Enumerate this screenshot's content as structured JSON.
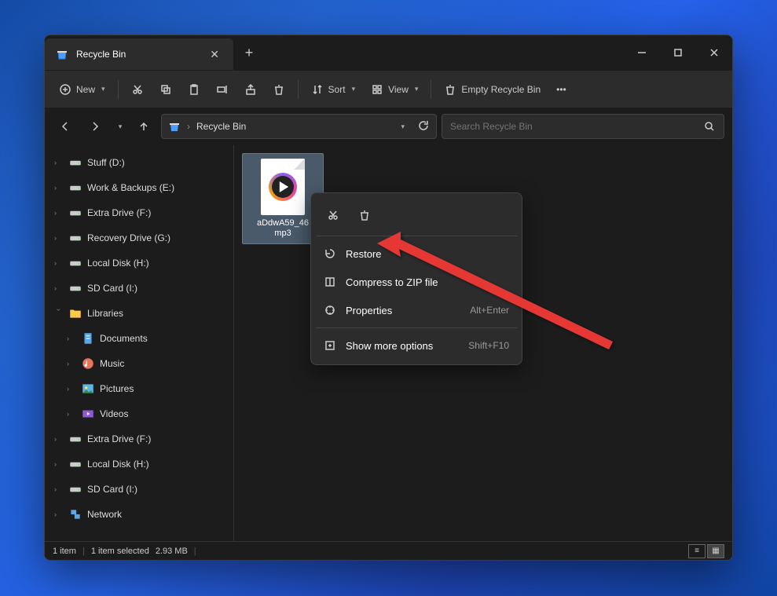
{
  "tab": {
    "title": "Recycle Bin"
  },
  "toolbar": {
    "new": "New",
    "sort": "Sort",
    "view": "View",
    "empty": "Empty Recycle Bin"
  },
  "address": {
    "location": "Recycle Bin"
  },
  "search": {
    "placeholder": "Search Recycle Bin"
  },
  "sidebar": [
    {
      "label": "Stuff (D:)",
      "icon": "drive"
    },
    {
      "label": "Work & Backups (E:)",
      "icon": "drive"
    },
    {
      "label": "Extra Drive (F:)",
      "icon": "drive"
    },
    {
      "label": "Recovery Drive (G:)",
      "icon": "drive"
    },
    {
      "label": "Local Disk (H:)",
      "icon": "drive"
    },
    {
      "label": "SD Card (I:)",
      "icon": "drive"
    },
    {
      "label": "Libraries",
      "icon": "folder",
      "expanded": true
    },
    {
      "label": "Documents",
      "icon": "doc",
      "indent": true
    },
    {
      "label": "Music",
      "icon": "music",
      "indent": true
    },
    {
      "label": "Pictures",
      "icon": "pic",
      "indent": true
    },
    {
      "label": "Videos",
      "icon": "vid",
      "indent": true
    },
    {
      "label": "Extra Drive (F:)",
      "icon": "drive"
    },
    {
      "label": "Local Disk (H:)",
      "icon": "drive"
    },
    {
      "label": "SD Card (I:)",
      "icon": "drive"
    },
    {
      "label": "Network",
      "icon": "net"
    }
  ],
  "file": {
    "name": "aDdwA59_46\nmp3"
  },
  "contextmenu": {
    "restore": "Restore",
    "compress": "Compress to ZIP file",
    "properties": "Properties",
    "properties_shortcut": "Alt+Enter",
    "showmore": "Show more options",
    "showmore_shortcut": "Shift+F10"
  },
  "status": {
    "items": "1 item",
    "selected": "1 item selected",
    "size": "2.93 MB"
  }
}
